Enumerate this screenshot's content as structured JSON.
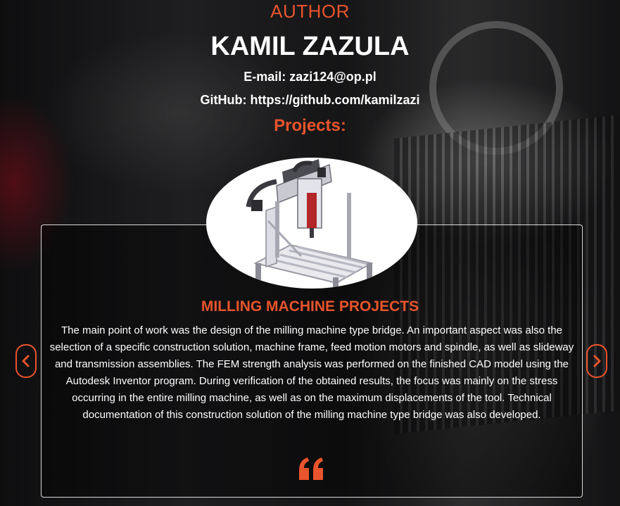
{
  "author": {
    "label": "AUTHOR",
    "name": "KAMIL ZAZULA",
    "email_line": "E-mail: zazi124@op.pl",
    "github_line": "GitHub: https://github.com/kamilzazi"
  },
  "projects": {
    "heading": "Projects:",
    "current": {
      "title": "MILLING MACHINE PROJECTS",
      "description": "The main point of work was the design of the milling machine type bridge. An important aspect was also the selection of a specific construction solution, machine frame, feed motion motors and spindle, as well as slideway and transmission assemblies. The FEM strength analysis was performed on the finished CAD model using the Autodesk Inventor program. During verification of the obtained results, the focus was mainly on the stress occurring in the entire milling machine, as well as on the maximum displacements of the tool. Technical documentation of this construction solution of the milling machine type bridge was also developed."
    }
  },
  "icons": {
    "prev": "chevron-left-icon",
    "next": "chevron-right-icon",
    "quote": "quote-icon"
  },
  "colors": {
    "accent": "#e8542c",
    "text": "#ffffff"
  }
}
